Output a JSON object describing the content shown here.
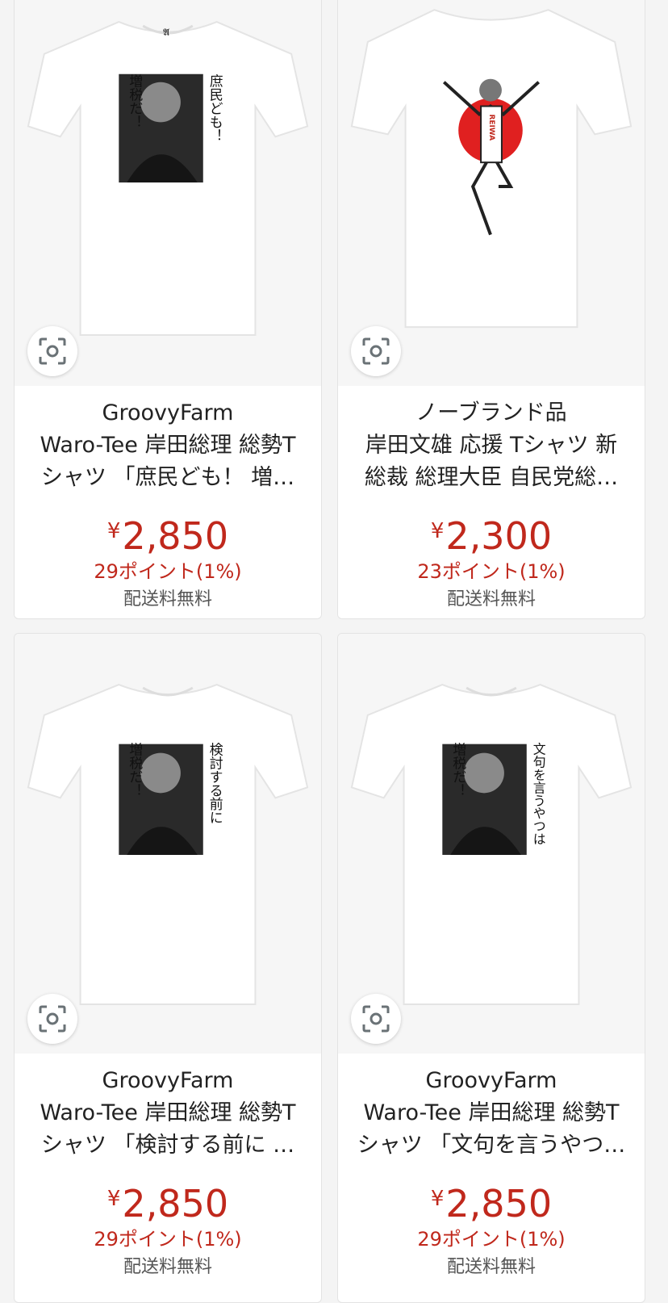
{
  "products": [
    {
      "brand": "GroovyFarm",
      "title": "Waro-Tee 岸田総理 総勢Tシャツ 「庶民ども！ 増…",
      "price_symbol": "¥",
      "price": "2,850",
      "points": "29ポイント(1%)",
      "shipping": "配送料無料",
      "print_text_right": "庶民ども！",
      "print_text_left": "増税だ！",
      "visual_search_icon": "camera-scan-icon"
    },
    {
      "brand": "ノーブランド品",
      "title": "岸田文雄 応援 Tシャツ 新総裁 総理大臣 自民党総…",
      "price_symbol": "¥",
      "price": "2,300",
      "points": "23ポイント(1%)",
      "shipping": "配送料無料",
      "print_text_vertical": "REIWA",
      "visual_search_icon": "camera-scan-icon"
    },
    {
      "brand": "GroovyFarm",
      "title": "Waro-Tee 岸田総理 総勢Tシャツ 「検討する前に …",
      "price_symbol": "¥",
      "price": "2,850",
      "points": "29ポイント(1%)",
      "shipping": "配送料無料",
      "print_text_right": "検討する前に",
      "print_text_left": "増税だ！",
      "visual_search_icon": "camera-scan-icon"
    },
    {
      "brand": "GroovyFarm",
      "title": "Waro-Tee 岸田総理 総勢Tシャツ 「文句を言うやつ…",
      "price_symbol": "¥",
      "price": "2,850",
      "points": "29ポイント(1%)",
      "shipping": "配送料無料",
      "print_text_right": "文句を言うやつは",
      "print_text_left": "増税だ！",
      "visual_search_icon": "camera-scan-icon"
    }
  ],
  "colors": {
    "price": "#c0281c",
    "shipping": "#555555",
    "sun_red": "#e02020"
  }
}
